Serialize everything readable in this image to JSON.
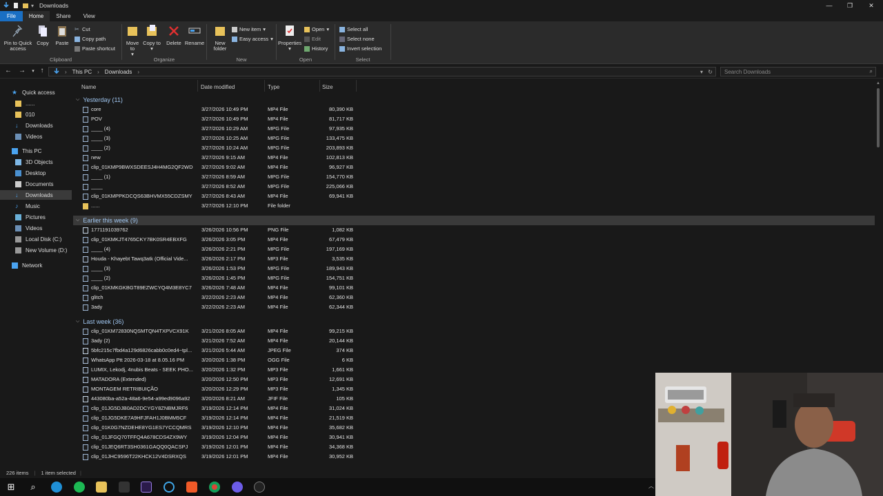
{
  "window": {
    "title": "Downloads"
  },
  "tabs": [
    "File",
    "Home",
    "Share",
    "View"
  ],
  "ribbon": {
    "clipboard": {
      "label": "Clipboard",
      "pin": "Pin to Quick access",
      "copy": "Copy",
      "paste": "Paste",
      "cut": "Cut",
      "copy_path": "Copy path",
      "paste_shortcut": "Paste shortcut"
    },
    "organize": {
      "label": "Organize",
      "move_to": "Move to",
      "copy_to": "Copy to",
      "delete": "Delete",
      "rename": "Rename"
    },
    "new": {
      "label": "New",
      "new_folder": "New folder",
      "new_item": "New item",
      "easy_access": "Easy access"
    },
    "open": {
      "label": "Open",
      "properties": "Properties",
      "open": "Open",
      "edit": "Edit",
      "history": "History"
    },
    "select": {
      "label": "Select",
      "select_all": "Select all",
      "select_none": "Select none",
      "invert": "Invert selection"
    }
  },
  "address": {
    "crumbs": [
      "This PC",
      "Downloads"
    ],
    "search_placeholder": "Search Downloads"
  },
  "nav": {
    "quick_access": "Quick access",
    "qa_items": [
      "......",
      "010",
      "Downloads",
      "Videos"
    ],
    "this_pc": "This PC",
    "pc_items": [
      "3D Objects",
      "Desktop",
      "Documents",
      "Downloads",
      "Music",
      "Pictures",
      "Videos",
      "Local Disk (C:)",
      "New Volume (D:)"
    ],
    "network": "Network"
  },
  "columns": {
    "name": "Name",
    "date": "Date modified",
    "type": "Type",
    "size": "Size"
  },
  "groups": [
    {
      "label": "Yesterday (11)",
      "items": [
        {
          "name": "core",
          "date": "3/27/2026 10:49 PM",
          "type": "MP4 File",
          "size": "80,390 KB"
        },
        {
          "name": "POV",
          "date": "3/27/2026 10:49 PM",
          "type": "MP4 File",
          "size": "81,717 KB"
        },
        {
          "name": "____ (4)",
          "date": "3/27/2026 10:29 AM",
          "type": "MPG File",
          "size": "97,935 KB"
        },
        {
          "name": "____ (3)",
          "date": "3/27/2026 10:25 AM",
          "type": "MPG File",
          "size": "133,475 KB"
        },
        {
          "name": "____ (2)",
          "date": "3/27/2026 10:24 AM",
          "type": "MPG File",
          "size": "203,893 KB"
        },
        {
          "name": "new",
          "date": "3/27/2026 9:15 AM",
          "type": "MP4 File",
          "size": "102,813 KB"
        },
        {
          "name": "clip_01KMP9BWXSDEESJ4H4MG2QF2WD",
          "date": "3/27/2026 9:02 AM",
          "type": "MP4 File",
          "size": "96,927 KB"
        },
        {
          "name": "____ (1)",
          "date": "3/27/2026 8:59 AM",
          "type": "MPG File",
          "size": "154,770 KB"
        },
        {
          "name": "____",
          "date": "3/27/2026 8:52 AM",
          "type": "MPG File",
          "size": "225,066 KB"
        },
        {
          "name": "clip_01KMPPKDCQS63BHVMX55CDZSMY",
          "date": "3/27/2026 8:43 AM",
          "type": "MP4 File",
          "size": "69,941 KB"
        },
        {
          "name": "......",
          "date": "3/27/2026 12:10 PM",
          "type": "File folder",
          "size": ""
        }
      ]
    },
    {
      "label": "Earlier this week (9)",
      "items": [
        {
          "name": "1771191039762",
          "date": "3/26/2026 10:56 PM",
          "type": "PNG File",
          "size": "1,082 KB"
        },
        {
          "name": "clip_01KMKJT4765CKY7BK0SR4EBXFG",
          "date": "3/26/2026 3:05 PM",
          "type": "MP4 File",
          "size": "67,479 KB"
        },
        {
          "name": "____ (4)",
          "date": "3/26/2026 2:21 PM",
          "type": "MPG File",
          "size": "197,169 KB"
        },
        {
          "name": "Houda - Khayebt Tawq3atk (Official Vide...",
          "date": "3/26/2026 2:17 PM",
          "type": "MP3 File",
          "size": "3,535 KB"
        },
        {
          "name": "____ (3)",
          "date": "3/26/2026 1:53 PM",
          "type": "MPG File",
          "size": "189,943 KB"
        },
        {
          "name": "____ (2)",
          "date": "3/26/2026 1:45 PM",
          "type": "MPG File",
          "size": "154,751 KB"
        },
        {
          "name": "clip_01KMKGKBGT89EZWCYQ4M3E8YC7",
          "date": "3/26/2026 7:48 AM",
          "type": "MP4 File",
          "size": "99,101 KB"
        },
        {
          "name": "glitch",
          "date": "3/22/2026 2:23 AM",
          "type": "MP4 File",
          "size": "62,360 KB"
        },
        {
          "name": "3ady",
          "date": "3/22/2026 2:23 AM",
          "type": "MP4 File",
          "size": "62,344 KB"
        }
      ]
    },
    {
      "label": "Last week (36)",
      "items": [
        {
          "name": "clip_01KM72830NQSMTQN4TXPVCX91K",
          "date": "3/21/2026 8:05 AM",
          "type": "MP4 File",
          "size": "99,215 KB"
        },
        {
          "name": "3ady (2)",
          "date": "3/21/2026 7:52 AM",
          "type": "MP4 File",
          "size": "20,144 KB"
        },
        {
          "name": "5bfc215c7fbd4a129d6826cabb0c0ed4~tpl...",
          "date": "3/21/2026 5:44 AM",
          "type": "JPEG File",
          "size": "374 KB"
        },
        {
          "name": "WhatsApp Ptt 2026-03-18 at 8.05.16 PM",
          "date": "3/20/2026 1:38 PM",
          "type": "OGG File",
          "size": "6 KB"
        },
        {
          "name": "LUMIX, Lekodj, 4nubis Beats - SEEK PHO...",
          "date": "3/20/2026 1:32 PM",
          "type": "MP3 File",
          "size": "1,661 KB"
        },
        {
          "name": "MATADORA (Extended)",
          "date": "3/20/2026 12:50 PM",
          "type": "MP3 File",
          "size": "12,691 KB"
        },
        {
          "name": "MONTAGEM RETRIBUIÇÃO",
          "date": "3/20/2026 12:29 PM",
          "type": "MP3 File",
          "size": "1,345 KB"
        },
        {
          "name": "443080ba-a52a-48a6-9e54-a99ed9096a92",
          "date": "3/20/2026 8:21 AM",
          "type": "JFIF File",
          "size": "105 KB"
        },
        {
          "name": "clip_01JG5DJB0AD2DCYGY8ZNBMJRF6",
          "date": "3/19/2026 12:14 PM",
          "type": "MP4 File",
          "size": "31,024 KB"
        },
        {
          "name": "clip_01JG5DKE7A9HFJFAH1J0BMM5CF",
          "date": "3/19/2026 12:14 PM",
          "type": "MP4 File",
          "size": "21,519 KB"
        },
        {
          "name": "clip_01K0G7NZDEHE8YG1ES7YCCQMRS",
          "date": "3/19/2026 12:10 PM",
          "type": "MP4 File",
          "size": "35,682 KB"
        },
        {
          "name": "clip_01JFGQ70TFFQ4A678CDS4ZX9WY",
          "date": "3/19/2026 12:04 PM",
          "type": "MP4 File",
          "size": "30,941 KB"
        },
        {
          "name": "clip_01JEQ6RT3SH0361GAQQ0QACSPJ",
          "date": "3/19/2026 12:01 PM",
          "type": "MP4 File",
          "size": "34,368 KB"
        },
        {
          "name": "clip_01JHC9596T22KHCK12V4DSRXQS",
          "date": "3/19/2026 12:01 PM",
          "type": "MP4 File",
          "size": "30,952 KB"
        }
      ]
    }
  ],
  "status": {
    "count": "226 items",
    "selected": "1 item selected"
  },
  "colors": {
    "accent": "#1a6fc4",
    "folder": "#e8c25a",
    "group_header": "#9fc5ef"
  }
}
